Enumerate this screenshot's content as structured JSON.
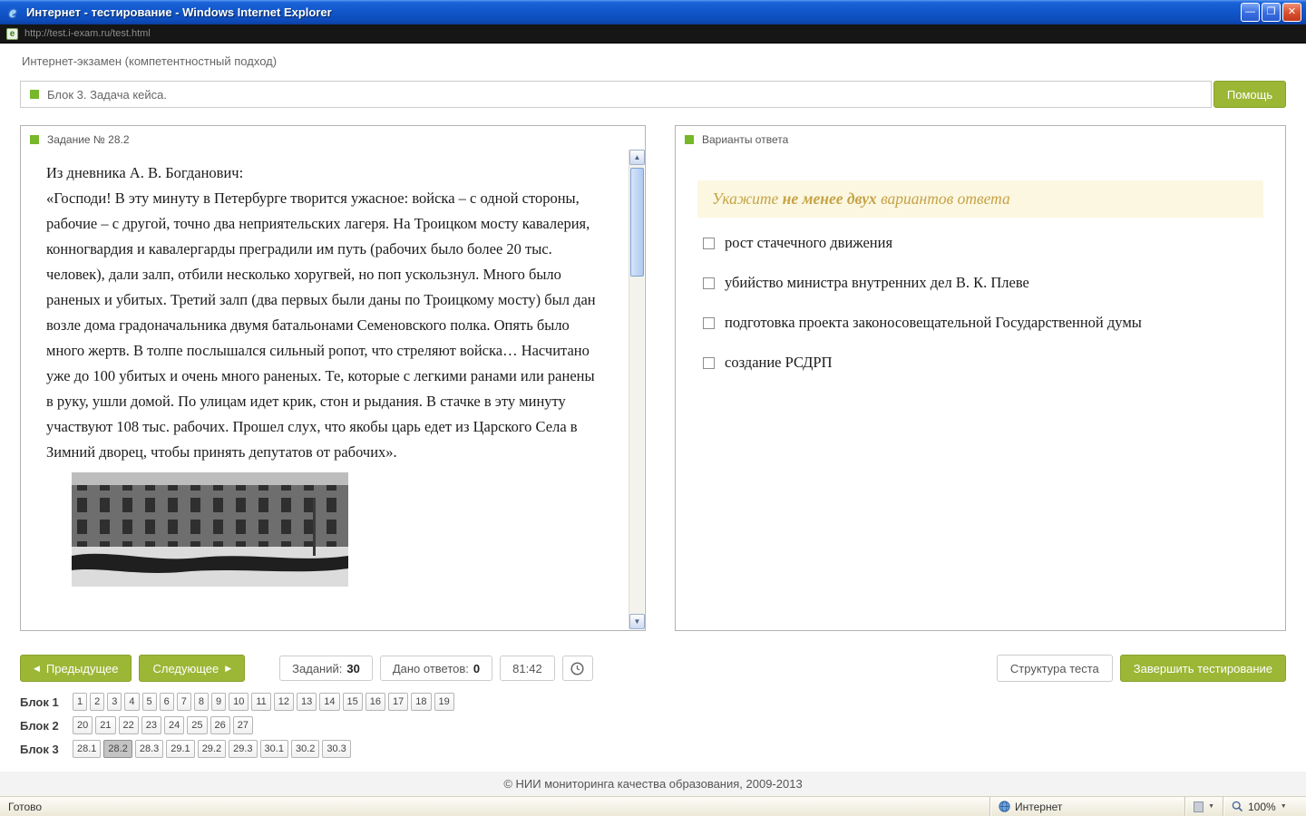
{
  "window": {
    "title": "Интернет - тестирование - Windows Internet Explorer",
    "url": "http://test.i-exam.ru/test.html",
    "status_ready": "Готово",
    "status_zone": "Интернет",
    "status_zoom": "100%"
  },
  "icons": {
    "minimize": "—",
    "maximize": "❐",
    "close": "✕",
    "prev_arrow": "◀",
    "next_arrow": "▶",
    "scroll_up": "▲",
    "scroll_down": "▼",
    "dropdown": "▼",
    "favicon_letter": "e"
  },
  "page": {
    "title": "Интернет-экзамен (компетентностный подход)",
    "block_title": "Блок 3. Задача кейса.",
    "help": "Помощь",
    "footer": "© НИИ мониторинга качества образования, 2009-2013"
  },
  "task": {
    "title": "Задание № 28.2",
    "intro": "Из дневника А. В. Богданович:",
    "quote": "«Господи! В эту минуту в Петербурге творится ужасное: войска – с одной стороны, рабочие – с другой, точно два неприятельских лагеря. На Троицком мосту кавалерия, конногвардия и кавалергарды преградили им путь (рабочих было более 20 тыс. человек), дали залп, отбили несколько хоругвей, но поп ускользнул. Много было раненых и убитых. Третий залп (два первых были даны по Троицкому мосту) был дан возле дома  градоначальника двумя батальонами Семеновского полка. Опять было много жертв. В толпе послышался сильный ропот, что стреляют войска… Насчитано уже до 100 убитых и очень много раненых. Те, которые с легкими ранами или ранены в руку, ушли домой. По улицам идет крик, стон и рыдания. В стачке в эту минуту участвуют 108 тыс. рабочих. Прошел слух, что якобы царь едет из Царского Села в Зимний дворец, чтобы принять депутатов от рабочих»."
  },
  "answers": {
    "title": "Варианты ответа",
    "hint_prefix": "Укажите ",
    "hint_bold": "не менее двух",
    "hint_suffix": " вариантов ответа",
    "options": [
      "рост стачечного движения",
      "убийство министра внутренних дел В. К. Плеве",
      "подготовка проекта законосовещательной Государственной думы",
      "создание РСДРП"
    ]
  },
  "controls": {
    "prev": "Предыдущее",
    "next": "Следующее",
    "tasks_label": "Заданий:",
    "tasks_value": "30",
    "answered_label": "Дано ответов:",
    "answered_value": "0",
    "timer": "81:42",
    "structure": "Структура теста",
    "finish": "Завершить тестирование"
  },
  "blocks": [
    {
      "label": "Блок 1",
      "items": [
        "1",
        "2",
        "3",
        "4",
        "5",
        "6",
        "7",
        "8",
        "9",
        "10",
        "11",
        "12",
        "13",
        "14",
        "15",
        "16",
        "17",
        "18",
        "19"
      ]
    },
    {
      "label": "Блок 2",
      "items": [
        "20",
        "21",
        "22",
        "23",
        "24",
        "25",
        "26",
        "27"
      ]
    },
    {
      "label": "Блок 3",
      "items": [
        "28.1",
        {
          "t": "28.2",
          "sel": true
        },
        "28.3",
        "29.1",
        "29.2",
        "29.3",
        "30.1",
        "30.2",
        "30.3"
      ]
    }
  ],
  "colors": {
    "accent_green": "#9cb636",
    "square_green": "#76b82a",
    "hint_text": "#c5a345",
    "hint_bg": "#fcf7e1"
  }
}
